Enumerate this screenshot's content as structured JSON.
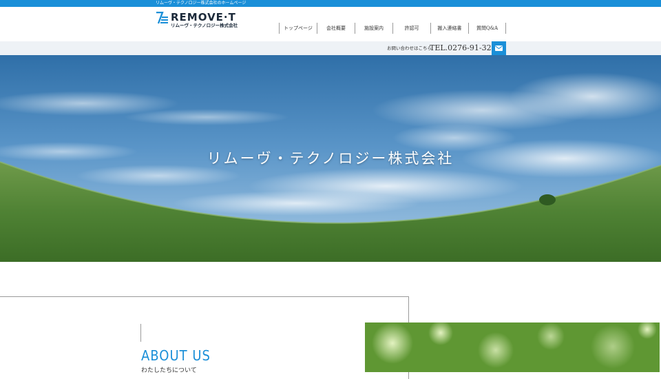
{
  "topbar": {
    "text": "リムーヴ・テクノロジー株式会社のホームページ"
  },
  "logo": {
    "main": "REMOVE·T",
    "sub": "リムーヴ・テクノロジー株式会社"
  },
  "nav": {
    "items": [
      {
        "label": "トップページ"
      },
      {
        "label": "会社概要"
      },
      {
        "label": "施設案内"
      },
      {
        "label": "許認可"
      },
      {
        "label": "搬入連絡書"
      },
      {
        "label": "質問Q&A"
      }
    ]
  },
  "contact": {
    "label": "お問い合わせはこちら",
    "tel": "TEL.0276-91-3211",
    "mail_icon": "envelope-icon"
  },
  "hero": {
    "title": "リムーヴ・テクノロジー株式会社"
  },
  "about": {
    "title": "ABOUT US",
    "subtitle": "わたしたちについて"
  },
  "colors": {
    "accent": "#1a8fd8",
    "header_bg": "#ffffff",
    "contact_bg": "#eef2f6",
    "logo_text": "#1c2a3a"
  }
}
